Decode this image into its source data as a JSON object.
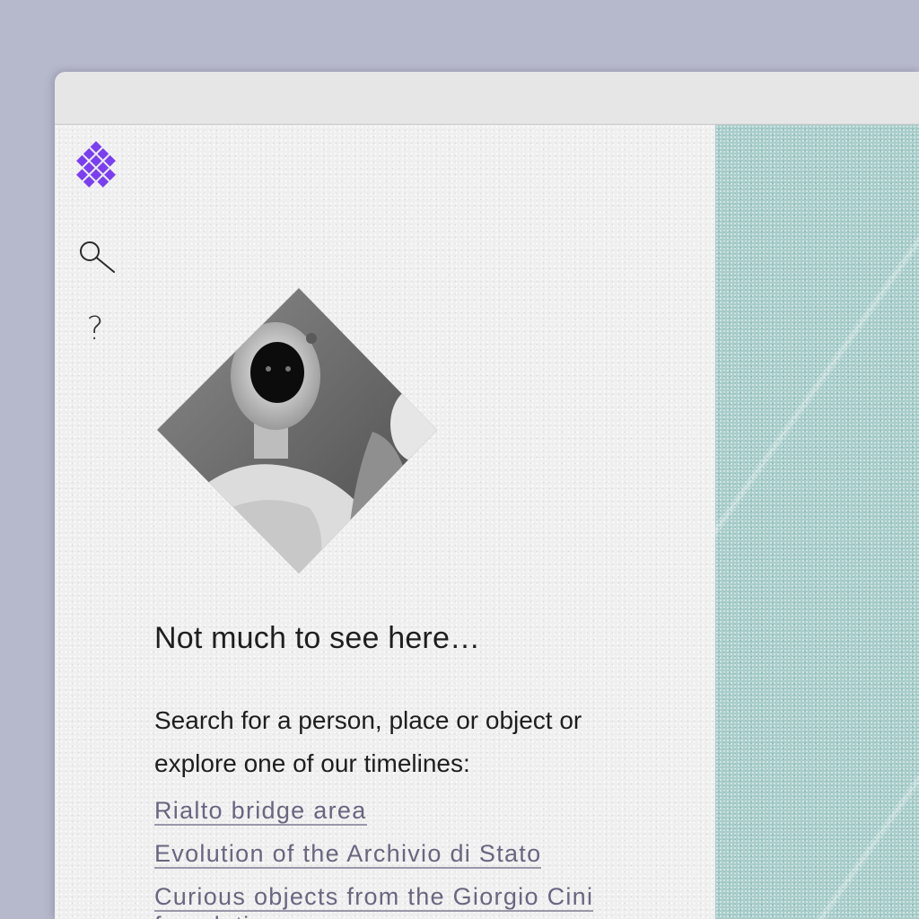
{
  "window": {
    "titlebar": ""
  },
  "sidebar": {
    "logo": "diamond-grid-logo",
    "icons": [
      "search-icon",
      "help-icon"
    ],
    "help_glyph": "?"
  },
  "empty_state": {
    "heading": "Not much to see here…",
    "description": "Search for a person, place or object or explore one of our timelines:",
    "timelines": [
      {
        "label": "Rialto bridge area"
      },
      {
        "label": "Evolution of the Archivio di Stato"
      },
      {
        "label": "Curious objects from the Giorgio Cini foundation"
      }
    ]
  },
  "colors": {
    "accent": "#7a3ff2",
    "panel_bg": "#efefef",
    "map_bg": "#a8cdcb",
    "link": "#6a6580",
    "backdrop": "#b6b8cb"
  }
}
